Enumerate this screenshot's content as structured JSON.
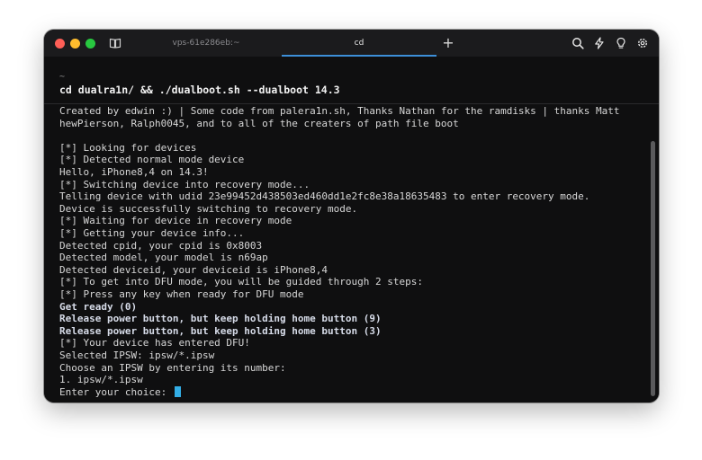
{
  "window": {
    "tabs": [
      {
        "label": "vps-61e286eb:~",
        "active": false
      },
      {
        "label": "cd",
        "active": true
      }
    ],
    "new_tab_label": "+",
    "icons": [
      "book-icon",
      "search-icon",
      "lightning-icon",
      "bulb-icon",
      "gear-icon"
    ]
  },
  "terminal": {
    "prompt_symbol": "~",
    "command": "cd dualra1n/ && ./dualboot.sh --dualboot 14.3",
    "lines": [
      {
        "text": "Created by edwin :) | Some code from palera1n.sh, Thanks Nathan for the ramdisks | thanks Matt",
        "bold": false
      },
      {
        "text": "hewPierson, Ralph0045, and to all of the creaters of path file boot",
        "bold": false
      },
      {
        "text": "",
        "bold": false
      },
      {
        "text": "[*] Looking for devices",
        "bold": false
      },
      {
        "text": "[*] Detected normal mode device",
        "bold": false
      },
      {
        "text": "Hello, iPhone8,4 on 14.3!",
        "bold": false
      },
      {
        "text": "[*] Switching device into recovery mode...",
        "bold": false
      },
      {
        "text": "Telling device with udid 23e99452d438503ed460dd1e2fc8e38a18635483 to enter recovery mode.",
        "bold": false
      },
      {
        "text": "Device is successfully switching to recovery mode.",
        "bold": false
      },
      {
        "text": "[*] Waiting for device in recovery mode",
        "bold": false
      },
      {
        "text": "[*] Getting your device info...",
        "bold": false
      },
      {
        "text": "Detected cpid, your cpid is 0x8003",
        "bold": false
      },
      {
        "text": "Detected model, your model is n69ap",
        "bold": false
      },
      {
        "text": "Detected deviceid, your deviceid is iPhone8,4",
        "bold": false
      },
      {
        "text": "[*] To get into DFU mode, you will be guided through 2 steps:",
        "bold": false
      },
      {
        "text": "[*] Press any key when ready for DFU mode",
        "bold": false
      },
      {
        "text": "Get ready (0)",
        "bold": true
      },
      {
        "text": "Release power button, but keep holding home button (9)",
        "bold": true
      },
      {
        "text": "Release power button, but keep holding home button (3)",
        "bold": true
      },
      {
        "text": "[*] Your device has entered DFU!",
        "bold": false
      },
      {
        "text": "Selected IPSW: ipsw/*.ipsw",
        "bold": false
      },
      {
        "text": "Choose an IPSW by entering its number:",
        "bold": false
      },
      {
        "text": "1. ipsw/*.ipsw",
        "bold": false
      },
      {
        "text": "Enter your choice: ",
        "bold": false,
        "cursor": true
      }
    ]
  },
  "colors": {
    "background": "#0f0f10",
    "titlebar": "#1b1b1d",
    "tab_underline": "#3d8fd8",
    "cursor": "#33aee6",
    "text": "#d7d7d7"
  }
}
